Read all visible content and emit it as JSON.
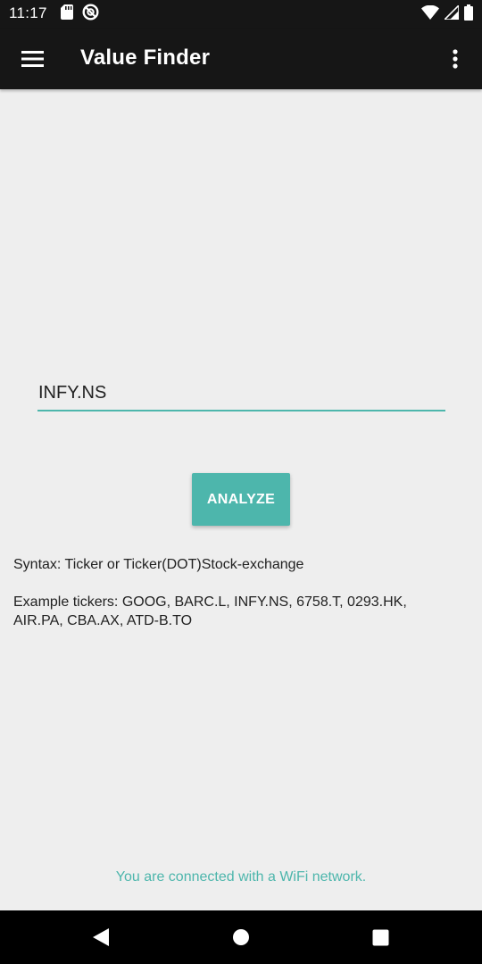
{
  "status_bar": {
    "time": "11:17",
    "left_icons": [
      "sd-card-icon",
      "no-data-saver-icon"
    ],
    "right_icons": [
      "wifi-icon",
      "cell-signal-icon",
      "battery-icon"
    ]
  },
  "app_bar": {
    "title": "Value Finder",
    "menu_icon": "hamburger-menu-icon",
    "overflow_icon": "more-vert-icon"
  },
  "ticker_input": {
    "value": "INFY.NS",
    "underline_color": "#4db6ac"
  },
  "analyze_button": {
    "label": "ANALYZE",
    "color": "#4db6ac"
  },
  "info": {
    "syntax": "Syntax: Ticker or Ticker(DOT)Stock-exchange",
    "examples": "Example tickers: GOOG, BARC.L, INFY.NS, 6758.T, 0293.HK, AIR.PA, CBA.AX, ATD-B.TO"
  },
  "footer": {
    "wifi_status": "You are connected with a WiFi network.",
    "color": "#4db6ac"
  },
  "nav_bar": {
    "buttons": [
      "back-icon",
      "home-icon",
      "recents-icon"
    ]
  },
  "colors": {
    "accent": "#4db6ac",
    "app_bar_bg": "#161616",
    "page_bg": "#eeeeee"
  }
}
